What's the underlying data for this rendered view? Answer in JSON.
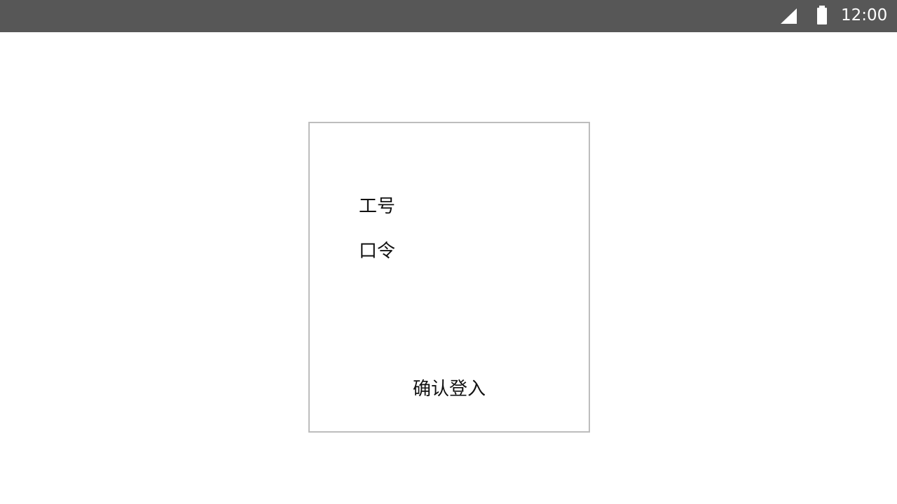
{
  "status_bar": {
    "time": "12:00",
    "signal_icon": "signal-icon",
    "battery_icon": "battery-icon"
  },
  "login_card": {
    "employee_id_label": "工号",
    "password_label": "口令",
    "login_button_label": "确认登入"
  },
  "colors": {
    "status_bar_background": "#575757",
    "page_background": "#ffffff",
    "card_border": "#bdbdbd",
    "text": "#111111"
  }
}
